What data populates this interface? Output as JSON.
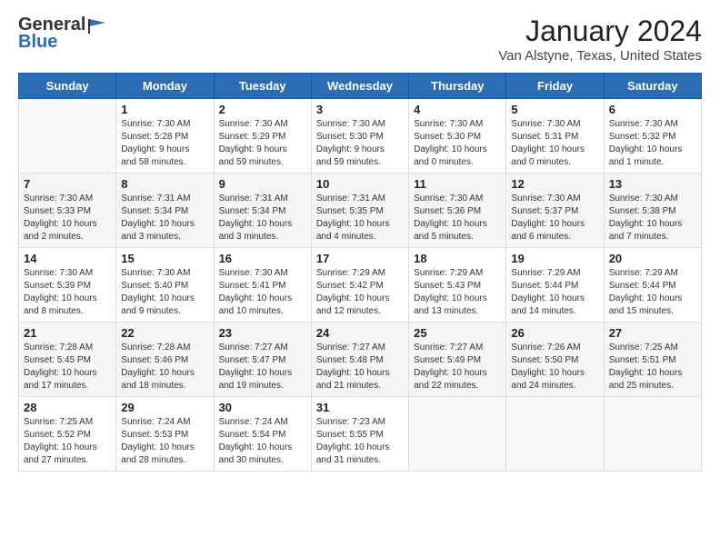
{
  "logo": {
    "general": "General",
    "blue": "Blue"
  },
  "title": "January 2024",
  "subtitle": "Van Alstyne, Texas, United States",
  "headers": [
    "Sunday",
    "Monday",
    "Tuesday",
    "Wednesday",
    "Thursday",
    "Friday",
    "Saturday"
  ],
  "weeks": [
    [
      {
        "day": "",
        "info": ""
      },
      {
        "day": "1",
        "info": "Sunrise: 7:30 AM\nSunset: 5:28 PM\nDaylight: 9 hours\nand 58 minutes."
      },
      {
        "day": "2",
        "info": "Sunrise: 7:30 AM\nSunset: 5:29 PM\nDaylight: 9 hours\nand 59 minutes."
      },
      {
        "day": "3",
        "info": "Sunrise: 7:30 AM\nSunset: 5:30 PM\nDaylight: 9 hours\nand 59 minutes."
      },
      {
        "day": "4",
        "info": "Sunrise: 7:30 AM\nSunset: 5:30 PM\nDaylight: 10 hours\nand 0 minutes."
      },
      {
        "day": "5",
        "info": "Sunrise: 7:30 AM\nSunset: 5:31 PM\nDaylight: 10 hours\nand 0 minutes."
      },
      {
        "day": "6",
        "info": "Sunrise: 7:30 AM\nSunset: 5:32 PM\nDaylight: 10 hours\nand 1 minute."
      }
    ],
    [
      {
        "day": "7",
        "info": "Sunrise: 7:30 AM\nSunset: 5:33 PM\nDaylight: 10 hours\nand 2 minutes."
      },
      {
        "day": "8",
        "info": "Sunrise: 7:31 AM\nSunset: 5:34 PM\nDaylight: 10 hours\nand 3 minutes."
      },
      {
        "day": "9",
        "info": "Sunrise: 7:31 AM\nSunset: 5:34 PM\nDaylight: 10 hours\nand 3 minutes."
      },
      {
        "day": "10",
        "info": "Sunrise: 7:31 AM\nSunset: 5:35 PM\nDaylight: 10 hours\nand 4 minutes."
      },
      {
        "day": "11",
        "info": "Sunrise: 7:30 AM\nSunset: 5:36 PM\nDaylight: 10 hours\nand 5 minutes."
      },
      {
        "day": "12",
        "info": "Sunrise: 7:30 AM\nSunset: 5:37 PM\nDaylight: 10 hours\nand 6 minutes."
      },
      {
        "day": "13",
        "info": "Sunrise: 7:30 AM\nSunset: 5:38 PM\nDaylight: 10 hours\nand 7 minutes."
      }
    ],
    [
      {
        "day": "14",
        "info": "Sunrise: 7:30 AM\nSunset: 5:39 PM\nDaylight: 10 hours\nand 8 minutes."
      },
      {
        "day": "15",
        "info": "Sunrise: 7:30 AM\nSunset: 5:40 PM\nDaylight: 10 hours\nand 9 minutes."
      },
      {
        "day": "16",
        "info": "Sunrise: 7:30 AM\nSunset: 5:41 PM\nDaylight: 10 hours\nand 10 minutes."
      },
      {
        "day": "17",
        "info": "Sunrise: 7:29 AM\nSunset: 5:42 PM\nDaylight: 10 hours\nand 12 minutes."
      },
      {
        "day": "18",
        "info": "Sunrise: 7:29 AM\nSunset: 5:43 PM\nDaylight: 10 hours\nand 13 minutes."
      },
      {
        "day": "19",
        "info": "Sunrise: 7:29 AM\nSunset: 5:44 PM\nDaylight: 10 hours\nand 14 minutes."
      },
      {
        "day": "20",
        "info": "Sunrise: 7:29 AM\nSunset: 5:44 PM\nDaylight: 10 hours\nand 15 minutes."
      }
    ],
    [
      {
        "day": "21",
        "info": "Sunrise: 7:28 AM\nSunset: 5:45 PM\nDaylight: 10 hours\nand 17 minutes."
      },
      {
        "day": "22",
        "info": "Sunrise: 7:28 AM\nSunset: 5:46 PM\nDaylight: 10 hours\nand 18 minutes."
      },
      {
        "day": "23",
        "info": "Sunrise: 7:27 AM\nSunset: 5:47 PM\nDaylight: 10 hours\nand 19 minutes."
      },
      {
        "day": "24",
        "info": "Sunrise: 7:27 AM\nSunset: 5:48 PM\nDaylight: 10 hours\nand 21 minutes."
      },
      {
        "day": "25",
        "info": "Sunrise: 7:27 AM\nSunset: 5:49 PM\nDaylight: 10 hours\nand 22 minutes."
      },
      {
        "day": "26",
        "info": "Sunrise: 7:26 AM\nSunset: 5:50 PM\nDaylight: 10 hours\nand 24 minutes."
      },
      {
        "day": "27",
        "info": "Sunrise: 7:25 AM\nSunset: 5:51 PM\nDaylight: 10 hours\nand 25 minutes."
      }
    ],
    [
      {
        "day": "28",
        "info": "Sunrise: 7:25 AM\nSunset: 5:52 PM\nDaylight: 10 hours\nand 27 minutes."
      },
      {
        "day": "29",
        "info": "Sunrise: 7:24 AM\nSunset: 5:53 PM\nDaylight: 10 hours\nand 28 minutes."
      },
      {
        "day": "30",
        "info": "Sunrise: 7:24 AM\nSunset: 5:54 PM\nDaylight: 10 hours\nand 30 minutes."
      },
      {
        "day": "31",
        "info": "Sunrise: 7:23 AM\nSunset: 5:55 PM\nDaylight: 10 hours\nand 31 minutes."
      },
      {
        "day": "",
        "info": ""
      },
      {
        "day": "",
        "info": ""
      },
      {
        "day": "",
        "info": ""
      }
    ]
  ]
}
